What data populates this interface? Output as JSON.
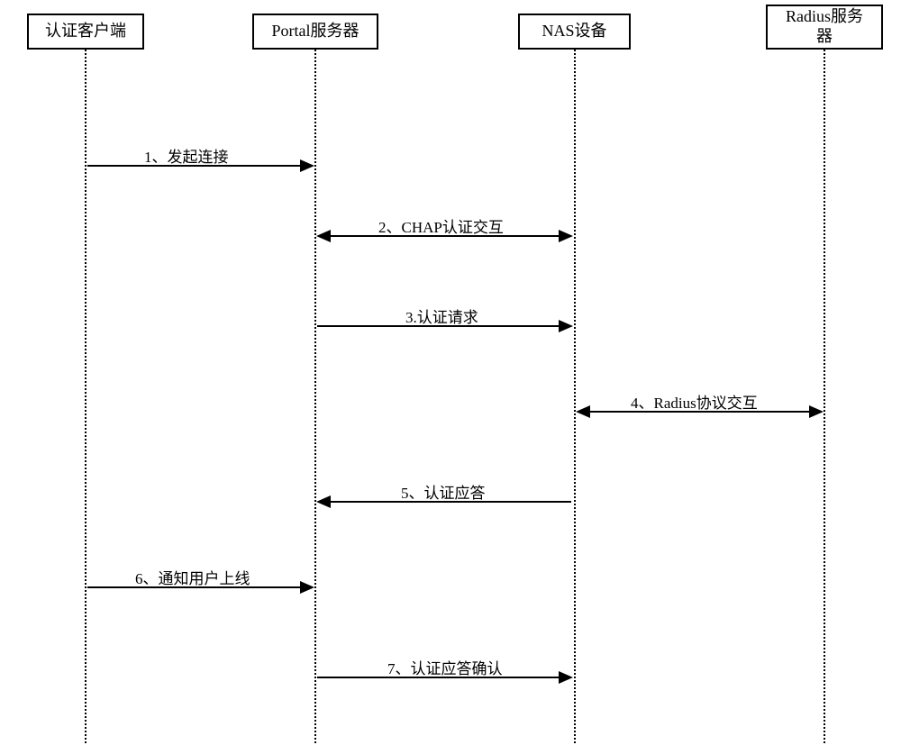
{
  "participants": {
    "client": "认证客户端",
    "portal": "Portal服务器",
    "nas": "NAS设备",
    "radius_line1": "Radius服务",
    "radius_line2": "器"
  },
  "messages": {
    "m1": "1、发起连接",
    "m2": "2、CHAP认证交互",
    "m3": "3.认证请求",
    "m4": "4、Radius协议交互",
    "m5": "5、认证应答",
    "m6": "6、通知用户上线",
    "m7": "7、认证应答确认"
  }
}
